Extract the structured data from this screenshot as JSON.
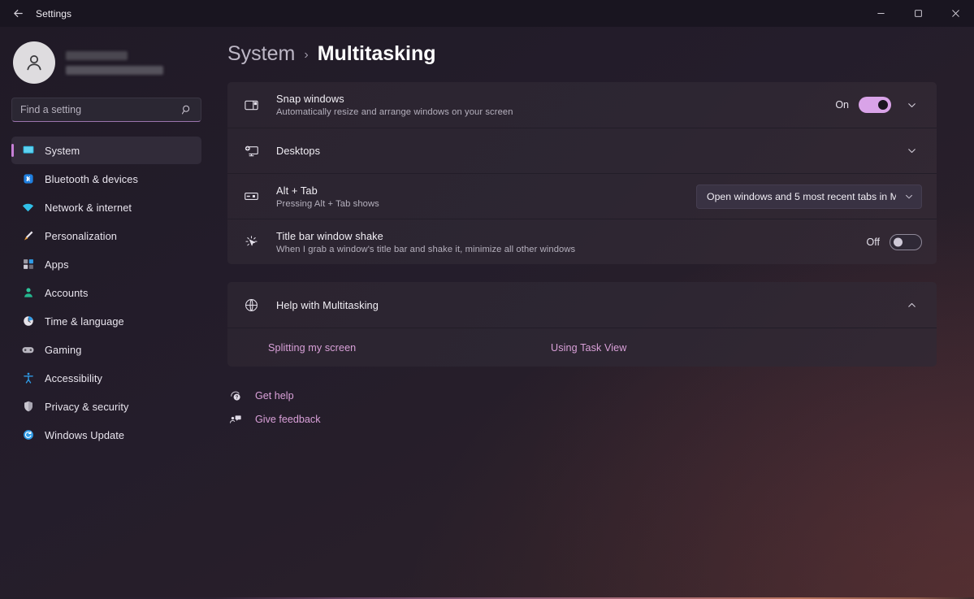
{
  "window": {
    "title": "Settings",
    "back_icon": "arrow-left-icon",
    "minimize_label": "—",
    "maximize_label": "☐",
    "close_label": "✕"
  },
  "account": {
    "avatar_icon": "user-avatar-icon",
    "name_redacted": true
  },
  "search": {
    "placeholder": "Find a setting",
    "value": "",
    "icon": "search-icon"
  },
  "sidebar": {
    "items": [
      {
        "label": "System",
        "icon": "monitor-icon",
        "active": true
      },
      {
        "label": "Bluetooth & devices",
        "icon": "bluetooth-icon",
        "active": false
      },
      {
        "label": "Network & internet",
        "icon": "wifi-icon",
        "active": false
      },
      {
        "label": "Personalization",
        "icon": "paintbrush-icon",
        "active": false
      },
      {
        "label": "Apps",
        "icon": "apps-grid-icon",
        "active": false
      },
      {
        "label": "Accounts",
        "icon": "person-icon",
        "active": false
      },
      {
        "label": "Time & language",
        "icon": "clock-icon",
        "active": false
      },
      {
        "label": "Gaming",
        "icon": "gamepad-icon",
        "active": false
      },
      {
        "label": "Accessibility",
        "icon": "accessibility-icon",
        "active": false
      },
      {
        "label": "Privacy & security",
        "icon": "shield-icon",
        "active": false
      },
      {
        "label": "Windows Update",
        "icon": "update-refresh-icon",
        "active": false
      }
    ]
  },
  "breadcrumb": {
    "root": "System",
    "separator": "›",
    "current": "Multitasking"
  },
  "settings": {
    "rows": [
      {
        "title": "Snap windows",
        "subtitle": "Automatically resize and arrange windows on your screen",
        "icon": "snap-layout-icon",
        "control": "toggle",
        "toggle_state": "On",
        "toggle_on": true,
        "expand_icon": "chevron-down-icon"
      },
      {
        "title": "Desktops",
        "subtitle": "",
        "icon": "desktop-add-icon",
        "control": "chevron",
        "expand_icon": "chevron-down-icon"
      },
      {
        "title": "Alt + Tab",
        "subtitle": "Pressing Alt + Tab shows",
        "icon": "alt-tab-icon",
        "control": "select",
        "select_value": "Open windows and 5 most recent tabs in M",
        "select_icon": "chevron-down-icon"
      },
      {
        "title": "Title bar window shake",
        "subtitle": "When I grab a window's title bar and shake it, minimize all other windows",
        "icon": "window-shake-icon",
        "control": "toggle",
        "toggle_state": "Off",
        "toggle_on": false
      }
    ]
  },
  "help": {
    "title": "Help with Multitasking",
    "icon": "globe-icon",
    "collapse_icon": "chevron-up-icon",
    "links": [
      {
        "label": "Splitting my screen"
      },
      {
        "label": "Using Task View"
      }
    ]
  },
  "footer": {
    "items": [
      {
        "label": "Get help",
        "icon": "help-question-icon"
      },
      {
        "label": "Give feedback",
        "icon": "feedback-icon"
      }
    ]
  },
  "colors": {
    "accent_pink": "#c77fd6",
    "link_pink": "#d9a0d8",
    "toggle_on": "#d9a3e8",
    "card_bg": "#2d2632",
    "page_bg": "#241d2b"
  }
}
